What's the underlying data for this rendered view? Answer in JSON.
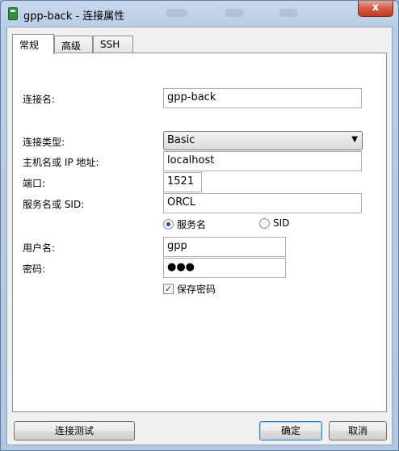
{
  "window": {
    "title": "gpp-back - 连接属性",
    "close_glyph": "x"
  },
  "tabs": [
    {
      "label": "常规",
      "active": true
    },
    {
      "label": "高级",
      "active": false
    },
    {
      "label": "SSH",
      "active": false
    }
  ],
  "form": {
    "connection_name_label": "连接名:",
    "connection_name_value": "gpp-back",
    "connection_type_label": "连接类型:",
    "connection_type_value": "Basic",
    "host_label": "主机名或 IP 地址:",
    "host_value": "localhost",
    "port_label": "端口:",
    "port_value": "1521",
    "service_label": "服务名或 SID:",
    "service_value": "ORCL",
    "radio_service_name": "服务名",
    "radio_sid": "SID",
    "radio_selected": "服务名",
    "username_label": "用户名:",
    "username_value": "gpp",
    "password_label": "密码:",
    "password_value": "●●●",
    "save_password_label": "保存密码",
    "save_password_checked": true
  },
  "buttons": {
    "test": "连接测试",
    "ok": "确定",
    "cancel": "取消"
  }
}
